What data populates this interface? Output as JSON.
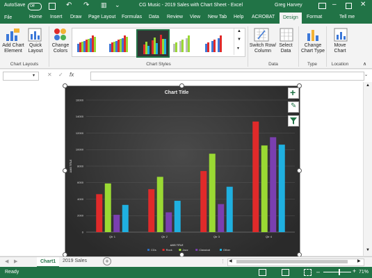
{
  "titlebar": {
    "autosave": "AutoSave",
    "autosave_state": "Off",
    "title": "CG Music - 2019 Sales with Chart Sheet  -  Excel",
    "user": "Greg Harvey"
  },
  "tabs": [
    "File",
    "Home",
    "Insert",
    "Draw",
    "Page Layout",
    "Formulas",
    "Data",
    "Review",
    "View",
    "New Tab",
    "Help",
    "ACROBAT",
    "Design",
    "Format",
    "Tell me"
  ],
  "ribbon": {
    "add_chart_element": "Add Chart Element",
    "quick_layout": "Quick Layout",
    "change_colors": "Change Colors",
    "switch_row_column": "Switch Row/ Column",
    "select_data": "Select Data",
    "change_chart_type": "Change Chart Type",
    "move_chart": "Move Chart",
    "group_chart_layouts": "Chart Layouts",
    "group_chart_styles": "Chart Styles",
    "group_data": "Data",
    "group_type": "Type",
    "group_location": "Location"
  },
  "formula_bar": {
    "name_box": "",
    "fx": "fx",
    "value": ""
  },
  "sheet_tabs": [
    "Chart1",
    "2019 Sales"
  ],
  "status": {
    "ready": "Ready",
    "zoom": "71%"
  },
  "colors": {
    "excel_green": "#217346",
    "rock": "#e02a2a",
    "jazz": "#9ad933",
    "classical": "#7a3fb0",
    "other": "#1fb0e0",
    "cds": "#2f6fbf"
  },
  "chart_data": {
    "type": "bar",
    "title": "Chart Title",
    "xlabel": "AXIS TITLE",
    "ylabel": "AXIS TITLE",
    "categories": [
      "Qtr 1",
      "Qtr 2",
      "Qtr 3",
      "Qtr 4"
    ],
    "ylim": [
      0,
      16000
    ],
    "yticks": [
      0,
      2000,
      4000,
      6000,
      8000,
      10000,
      12000,
      14000,
      16000
    ],
    "legend_position": "bottom",
    "series": [
      {
        "name": "CDs",
        "values": [
          0,
          0,
          0,
          0
        ]
      },
      {
        "name": "Rock",
        "values": [
          4600,
          5200,
          7400,
          13400
        ]
      },
      {
        "name": "Jazz",
        "values": [
          5900,
          6700,
          9500,
          10500
        ]
      },
      {
        "name": "Classical",
        "values": [
          2100,
          2400,
          3400,
          11500
        ]
      },
      {
        "name": "Other",
        "values": [
          3300,
          3800,
          5500,
          10600
        ]
      }
    ],
    "grid": true
  }
}
